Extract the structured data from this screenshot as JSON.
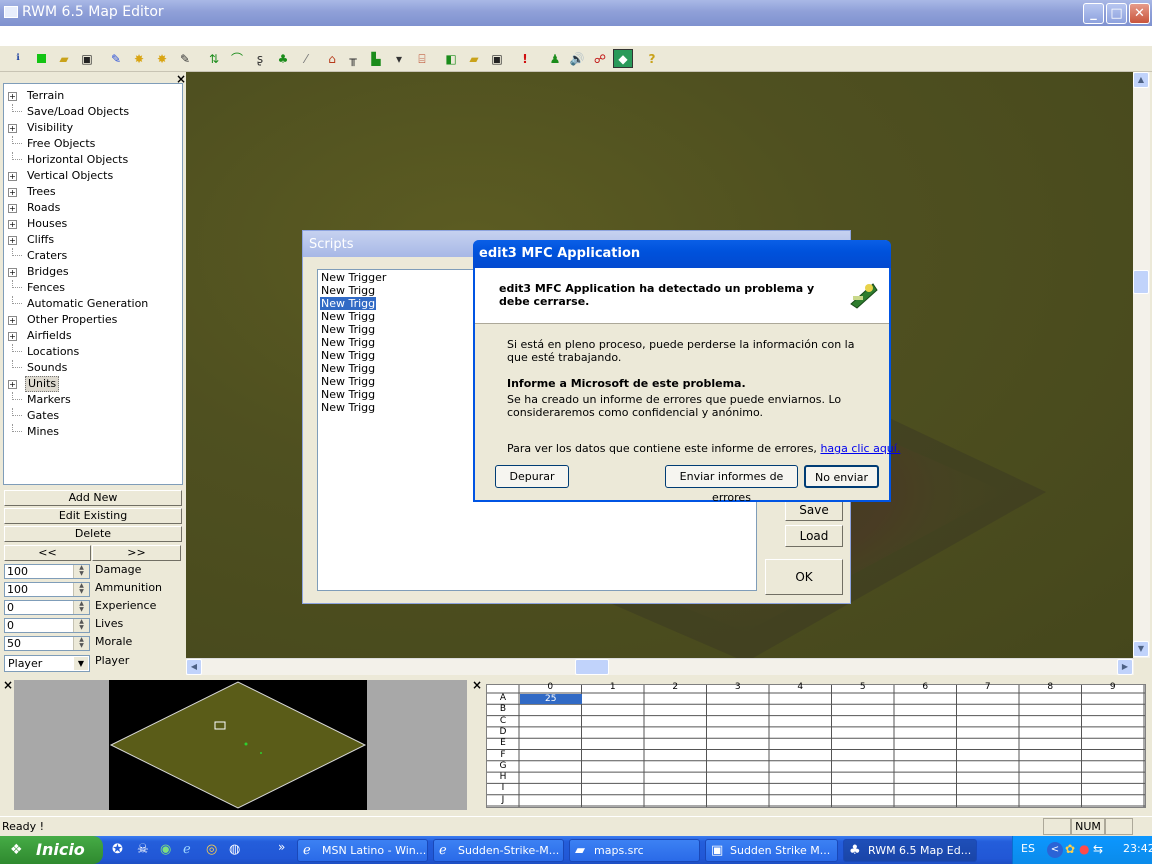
{
  "window": {
    "title": "RWM 6.5 Map Editor",
    "min": "_",
    "max": "□",
    "close": "✕"
  },
  "tree": {
    "close": "×",
    "items": [
      {
        "label": "Terrain",
        "expandable": true
      },
      {
        "label": "Save/Load Objects",
        "expandable": false
      },
      {
        "label": "Visibility",
        "expandable": true
      },
      {
        "label": "Free Objects",
        "expandable": false
      },
      {
        "label": "Horizontal Objects",
        "expandable": false
      },
      {
        "label": "Vertical Objects",
        "expandable": true
      },
      {
        "label": "Trees",
        "expandable": true
      },
      {
        "label": "Roads",
        "expandable": true
      },
      {
        "label": "Houses",
        "expandable": true
      },
      {
        "label": "Cliffs",
        "expandable": true
      },
      {
        "label": "Craters",
        "expandable": false
      },
      {
        "label": "Bridges",
        "expandable": true
      },
      {
        "label": "Fences",
        "expandable": false
      },
      {
        "label": "Automatic Generation",
        "expandable": false
      },
      {
        "label": "Other Properties",
        "expandable": true
      },
      {
        "label": "Airfields",
        "expandable": true
      },
      {
        "label": "Locations",
        "expandable": false
      },
      {
        "label": "Sounds",
        "expandable": false
      },
      {
        "label": "Units",
        "expandable": true,
        "selected": true
      },
      {
        "label": "Markers",
        "expandable": false
      },
      {
        "label": "Gates",
        "expandable": false
      },
      {
        "label": "Mines",
        "expandable": false
      }
    ]
  },
  "panel": {
    "add_new": "Add New",
    "edit_existing": "Edit Existing",
    "delete": "Delete",
    "prev": "<<",
    "next": ">>",
    "fields": [
      {
        "label": "Damage",
        "value": "100"
      },
      {
        "label": "Ammunition",
        "value": "100"
      },
      {
        "label": "Experience",
        "value": "0"
      },
      {
        "label": "Lives",
        "value": "0"
      },
      {
        "label": "Morale",
        "value": "50"
      }
    ],
    "player_select": "Player",
    "player_label": "Player"
  },
  "scripts": {
    "title": "Scripts",
    "triggers": [
      "New Trigger",
      "New Trigg",
      "New Trigg",
      "New Trigg",
      "New Trigg",
      "New Trigg",
      "New Trigg",
      "New Trigg",
      "New Trigg",
      "New Trigg",
      "New Trigg"
    ],
    "selected_index": 2,
    "save": "Save",
    "load": "Load",
    "ok": "OK"
  },
  "dialog": {
    "title": "edit3 MFC Application",
    "header": "edit3 MFC Application ha detectado un problema y debe cerrarse.",
    "p1": "Si está en pleno proceso, puede perderse la información con la que esté trabajando.",
    "bold": "Informe a Microsoft de este problema.",
    "p2": "Se ha creado un informe de errores que puede enviarnos. Lo consideraremos como confidencial y anónimo.",
    "p3": "Para ver los datos que contiene este informe de errores,",
    "link": "haga clic aquí.",
    "debug": "Depurar",
    "send": "Enviar informes de errores",
    "dont_send": "No enviar"
  },
  "grid": {
    "close": "×",
    "columns": [
      "0",
      "1",
      "2",
      "3",
      "4",
      "5",
      "6",
      "7",
      "8",
      "9"
    ],
    "rows": [
      "A",
      "B",
      "C",
      "D",
      "E",
      "F",
      "G",
      "H",
      "I",
      "J"
    ],
    "cell_A0": "25"
  },
  "minimap": {
    "close": "×"
  },
  "status": {
    "text": "Ready !",
    "num": "NUM"
  },
  "taskbar": {
    "start": "Inicio",
    "overflow": "»",
    "tasks": [
      {
        "label": "MSN Latino - Win...",
        "active": false
      },
      {
        "label": "Sudden-Strike-M...",
        "active": false
      },
      {
        "label": "maps.src",
        "active": false
      },
      {
        "label": "Sudden Strike M...",
        "active": false
      },
      {
        "label": "RWM 6.5 Map Ed...",
        "active": true
      }
    ],
    "lang": "ES",
    "clock": "23:42"
  }
}
